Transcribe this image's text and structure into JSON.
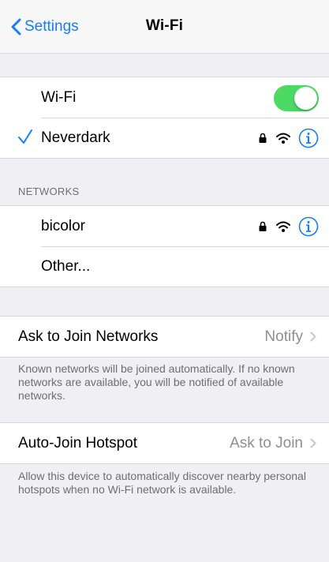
{
  "nav": {
    "back_label": "Settings",
    "title": "Wi-Fi"
  },
  "wifi": {
    "toggle_label": "Wi-Fi",
    "toggle_on": true,
    "connected_network": "Neverdark"
  },
  "networks": {
    "header": "NETWORKS",
    "items": [
      {
        "name": "bicolor",
        "secured": true
      },
      {
        "name": "Other..."
      }
    ]
  },
  "ask_to_join": {
    "label": "Ask to Join Networks",
    "value": "Notify",
    "footnote": "Known networks will be joined automatically. If no known networks are available, you will be notified of available networks."
  },
  "auto_join": {
    "label": "Auto-Join Hotspot",
    "value": "Ask to Join",
    "footnote": "Allow this device to automatically discover nearby personal hotspots when no Wi-Fi network is available."
  },
  "colors": {
    "accent": "#147efb",
    "toggle_on": "#4cd964",
    "background": "#efeff4"
  }
}
